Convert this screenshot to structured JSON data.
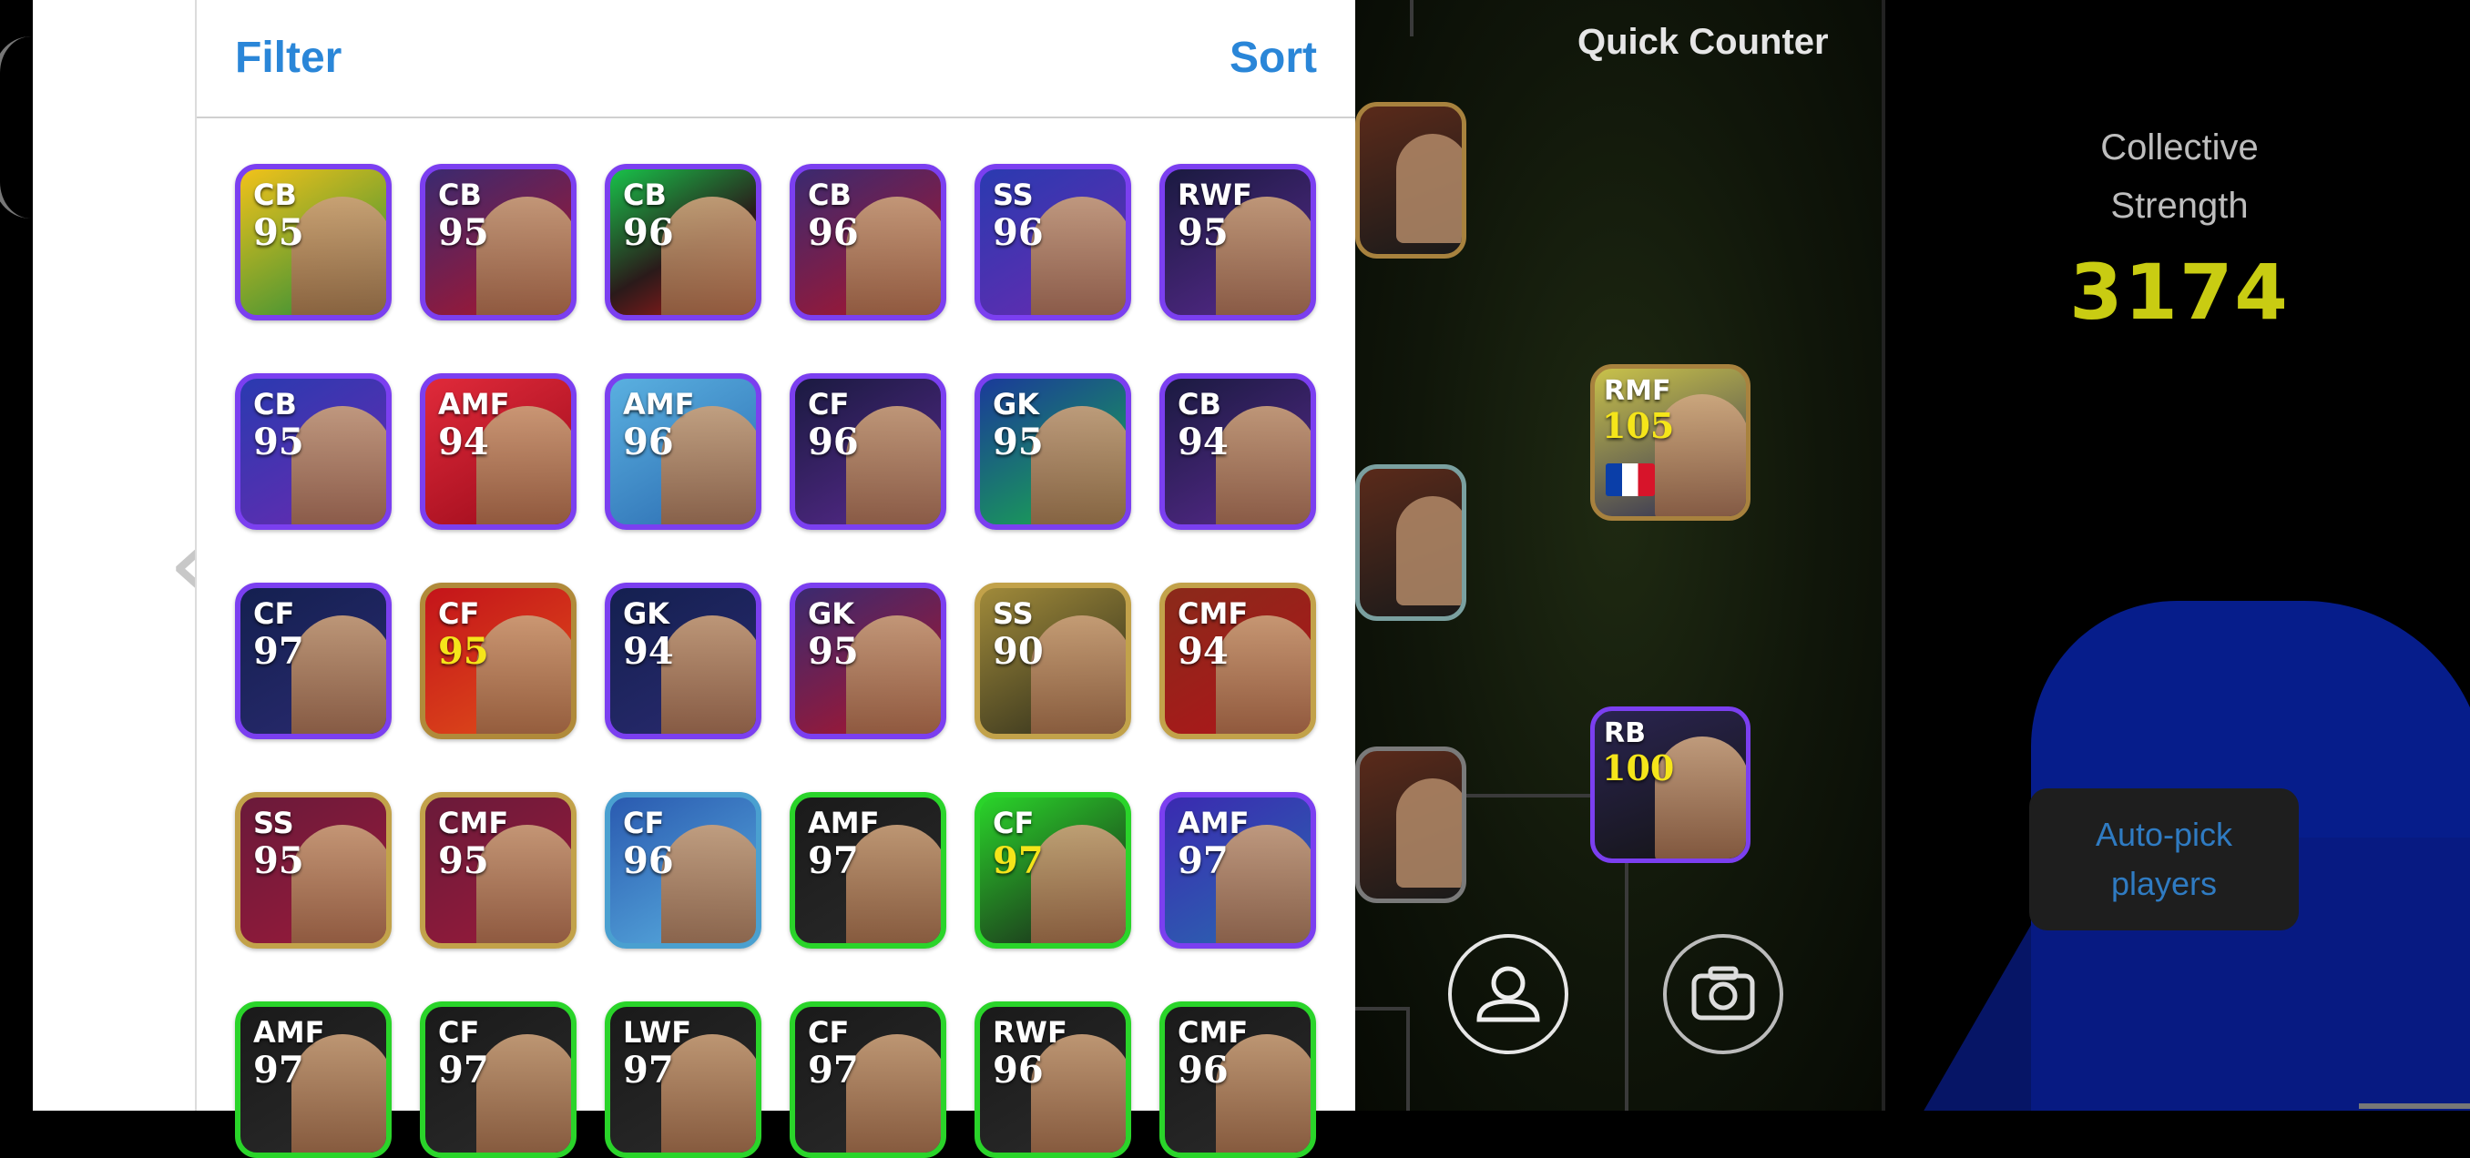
{
  "picker": {
    "filter_label": "Filter",
    "sort_label": "Sort",
    "cards": [
      {
        "pos": "CB",
        "rating": "95",
        "style": "gold-green"
      },
      {
        "pos": "CB",
        "rating": "95",
        "style": "purple-red"
      },
      {
        "pos": "CB",
        "rating": "96",
        "style": "green-red"
      },
      {
        "pos": "CB",
        "rating": "96",
        "style": "purple-red"
      },
      {
        "pos": "SS",
        "rating": "96",
        "style": "blue-purple"
      },
      {
        "pos": "RWF",
        "rating": "95",
        "style": "dark-purple"
      },
      {
        "pos": "CB",
        "rating": "95",
        "style": "blue-purple"
      },
      {
        "pos": "AMF",
        "rating": "94",
        "style": "red"
      },
      {
        "pos": "AMF",
        "rating": "96",
        "style": "sky"
      },
      {
        "pos": "CF",
        "rating": "96",
        "style": "dark-purple"
      },
      {
        "pos": "GK",
        "rating": "95",
        "style": "blue-green"
      },
      {
        "pos": "CB",
        "rating": "94",
        "style": "dark-purple"
      },
      {
        "pos": "CF",
        "rating": "97",
        "style": "navy"
      },
      {
        "pos": "CF",
        "rating": "95",
        "style": "red-gold",
        "gold": true
      },
      {
        "pos": "GK",
        "rating": "94",
        "style": "navy"
      },
      {
        "pos": "GK",
        "rating": "95",
        "style": "purple-red"
      },
      {
        "pos": "SS",
        "rating": "90",
        "style": "gold-dark"
      },
      {
        "pos": "CMF",
        "rating": "94",
        "style": "gold-red"
      },
      {
        "pos": "SS",
        "rating": "95",
        "style": "gold-wine"
      },
      {
        "pos": "CMF",
        "rating": "95",
        "style": "gold-wine"
      },
      {
        "pos": "CF",
        "rating": "96",
        "style": "sky-blue"
      },
      {
        "pos": "AMF",
        "rating": "97",
        "style": "green-dark"
      },
      {
        "pos": "CF",
        "rating": "97",
        "style": "green-light",
        "gold": true
      },
      {
        "pos": "AMF",
        "rating": "97",
        "style": "purple-blue"
      },
      {
        "pos": "AMF",
        "rating": "97",
        "style": "green-dark"
      },
      {
        "pos": "CF",
        "rating": "97",
        "style": "green-dark"
      },
      {
        "pos": "LWF",
        "rating": "97",
        "style": "green-dark"
      },
      {
        "pos": "CF",
        "rating": "97",
        "style": "green-dark"
      },
      {
        "pos": "RWF",
        "rating": "96",
        "style": "green-dark"
      },
      {
        "pos": "CMF",
        "rating": "96",
        "style": "green-dark"
      }
    ]
  },
  "field": {
    "title": "Quick Counter",
    "players": [
      {
        "pos": "RMF",
        "rating": "105"
      },
      {
        "pos": "RB",
        "rating": "100"
      }
    ]
  },
  "stats": {
    "label_line1": "Collective",
    "label_line2": "Strength",
    "value": "3174"
  },
  "auto_pick": {
    "line1": "Auto-pick",
    "line2": "players"
  },
  "icons": {
    "prev": "chevron-left-icon",
    "profile": "user-icon",
    "camera": "camera-icon"
  },
  "colors": {
    "link_blue": "#2a86d8",
    "strength_yellow": "#c9cc12"
  }
}
